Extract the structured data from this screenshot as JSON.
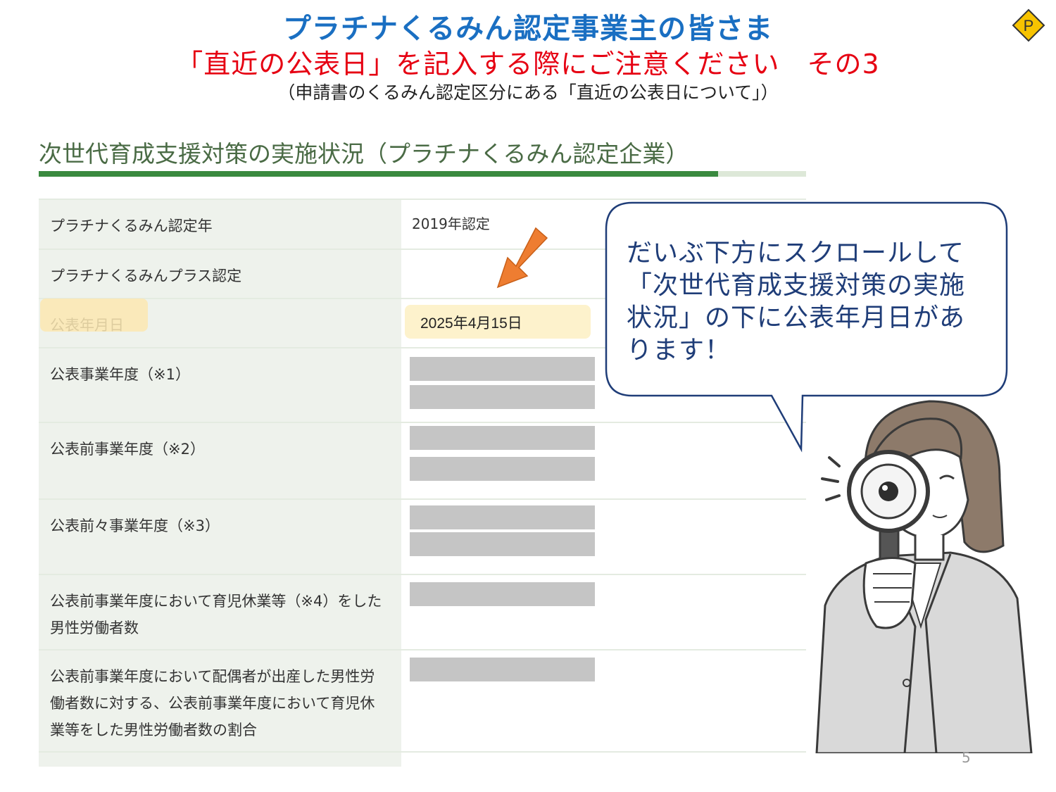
{
  "header": {
    "title_line1": "プラチナくるみん認定事業主の皆さま",
    "title_line2": "「直近の公表日」を記入する際にご注意ください　その3",
    "title_line3": "（申請書のくるみん認定区分にある「直近の公表日について」）",
    "badge": "P"
  },
  "section": {
    "heading": "次世代育成支援対策の実施状況（プラチナくるみん認定企業）"
  },
  "table": {
    "rows": [
      {
        "label": "プラチナくるみん認定年",
        "value": "2019年認定"
      },
      {
        "label": "プラチナくるみんプラス認定",
        "value": ""
      },
      {
        "label": "公表年月日",
        "value": "2025年4月15日"
      },
      {
        "label": "公表事業年度（※1）",
        "value": ""
      },
      {
        "label": "公表前事業年度（※2）",
        "value": ""
      },
      {
        "label": "公表前々事業年度（※3）",
        "value": ""
      },
      {
        "label": "公表前事業年度において育児休業等（※4）をした男性労働者数",
        "value": ""
      },
      {
        "label": "公表前事業年度において配偶者が出産した男性労働者数に対する、公表前事業年度において育児休業等をした男性労働者数の割合",
        "value": ""
      }
    ]
  },
  "callout": {
    "text": "だいぶ下方にスクロールして「次世代育成支援対策の実施状況」の下に公表年月日があります！"
  },
  "footer": {
    "page_number": "5"
  },
  "colors": {
    "title_blue": "#1a6fc2",
    "title_red": "#e60012",
    "heading_green": "#3a8a3f",
    "highlight": "#fdf2cc",
    "arrow": "#ee7d31",
    "callout_text": "#1f3d78"
  },
  "icons": {
    "badge": "p-diamond-icon",
    "arrow": "down-left-arrow-icon",
    "illustration": "woman-with-magnifier-illustration"
  }
}
